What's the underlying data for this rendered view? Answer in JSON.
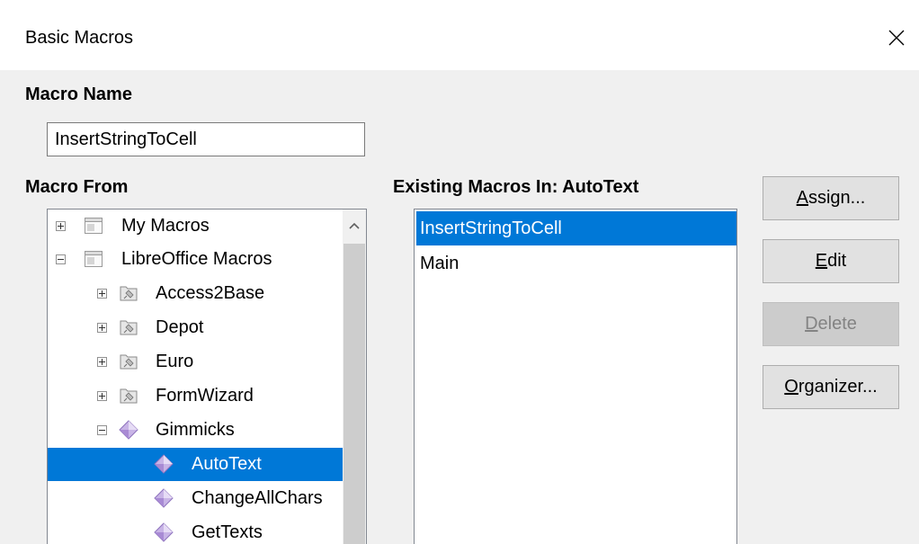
{
  "dialog": {
    "title": "Basic Macros",
    "close_icon": "close-icon"
  },
  "macro_name": {
    "label": "Macro Name",
    "value": "InsertStringToCell"
  },
  "macro_from": {
    "label": "Macro From",
    "items": [
      {
        "label": "My Macros",
        "expander": "plus",
        "icon": "library-container-icon"
      },
      {
        "label": "LibreOffice Macros",
        "expander": "minus",
        "icon": "library-container-icon"
      },
      {
        "label": "Access2Base",
        "expander": "plus",
        "icon": "basic-library-icon"
      },
      {
        "label": "Depot",
        "expander": "plus",
        "icon": "basic-library-icon"
      },
      {
        "label": "Euro",
        "expander": "plus",
        "icon": "basic-library-icon"
      },
      {
        "label": "FormWizard",
        "expander": "plus",
        "icon": "basic-library-icon"
      },
      {
        "label": "Gimmicks",
        "expander": "minus",
        "icon": "basic-module-icon"
      },
      {
        "label": "AutoText",
        "expander": "none",
        "icon": "basic-module-icon",
        "selected": true
      },
      {
        "label": "ChangeAllChars",
        "expander": "none",
        "icon": "basic-module-icon"
      },
      {
        "label": "GetTexts",
        "expander": "none",
        "icon": "basic-module-icon"
      }
    ],
    "scroll_up_icon": "chevron-up-icon"
  },
  "existing_macros": {
    "label": "Existing Macros In: AutoText",
    "items": [
      {
        "label": "InsertStringToCell",
        "selected": true
      },
      {
        "label": "Main",
        "selected": false
      }
    ]
  },
  "buttons": {
    "assign": {
      "mnemonic": "A",
      "rest": "ssign..."
    },
    "edit": {
      "mnemonic": "E",
      "rest": "dit"
    },
    "delete": {
      "mnemonic": "D",
      "rest": "elete",
      "disabled": true
    },
    "organizer": {
      "mnemonic": "O",
      "rest": "rganizer..."
    }
  },
  "colors": {
    "selection": "#0078d7",
    "dialog_bg": "#f0f0f0",
    "disabled_button_bg": "#cccccc"
  }
}
